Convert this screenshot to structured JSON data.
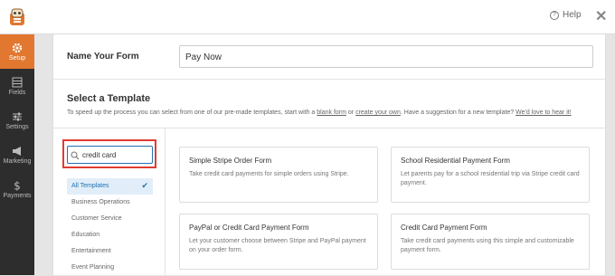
{
  "topbar": {
    "help_label": "Help",
    "close_glyph": "✕"
  },
  "sidebar": {
    "items": [
      {
        "label": "Setup",
        "icon": "gear-icon",
        "active": true
      },
      {
        "label": "Fields",
        "icon": "fields-icon",
        "active": false
      },
      {
        "label": "Settings",
        "icon": "sliders-icon",
        "active": false
      },
      {
        "label": "Marketing",
        "icon": "megaphone-icon",
        "active": false
      },
      {
        "label": "Payments",
        "icon": "dollar-icon",
        "active": false
      }
    ]
  },
  "form": {
    "name_label": "Name Your Form",
    "name_value": "Pay Now"
  },
  "template_section": {
    "title": "Select a Template",
    "desc_prefix": "To speed up the process you can select from one of our pre-made templates, start with a ",
    "link_blank": "blank form",
    "desc_mid1": " or ",
    "link_create": "create your own",
    "desc_mid2": ". Have a suggestion for a new template? ",
    "link_suggest": "We'd love to hear it!"
  },
  "search": {
    "value": "credit card",
    "highlight_color": "#e03c31"
  },
  "categories": [
    {
      "label": "All Templates",
      "active": true
    },
    {
      "label": "Business Operations",
      "active": false
    },
    {
      "label": "Customer Service",
      "active": false
    },
    {
      "label": "Education",
      "active": false
    },
    {
      "label": "Entertainment",
      "active": false
    },
    {
      "label": "Event Planning",
      "active": false
    }
  ],
  "templates": [
    {
      "title": "Simple Stripe Order Form",
      "desc": "Take credit card payments for simple orders using Stripe."
    },
    {
      "title": "School Residential Payment Form",
      "desc": "Let parents pay for a school residential trip via Stripe credit card payment."
    },
    {
      "title": "PayPal or Credit Card Payment Form",
      "desc": "Let your customer choose between Stripe and PayPal payment on your order form."
    },
    {
      "title": "Credit Card Payment Form",
      "desc": "Take credit card payments using this simple and customizable payment form."
    }
  ],
  "colors": {
    "accent": "#e27730",
    "sidebar_bg": "#2d2d2d",
    "link_blue": "#2271b1"
  }
}
